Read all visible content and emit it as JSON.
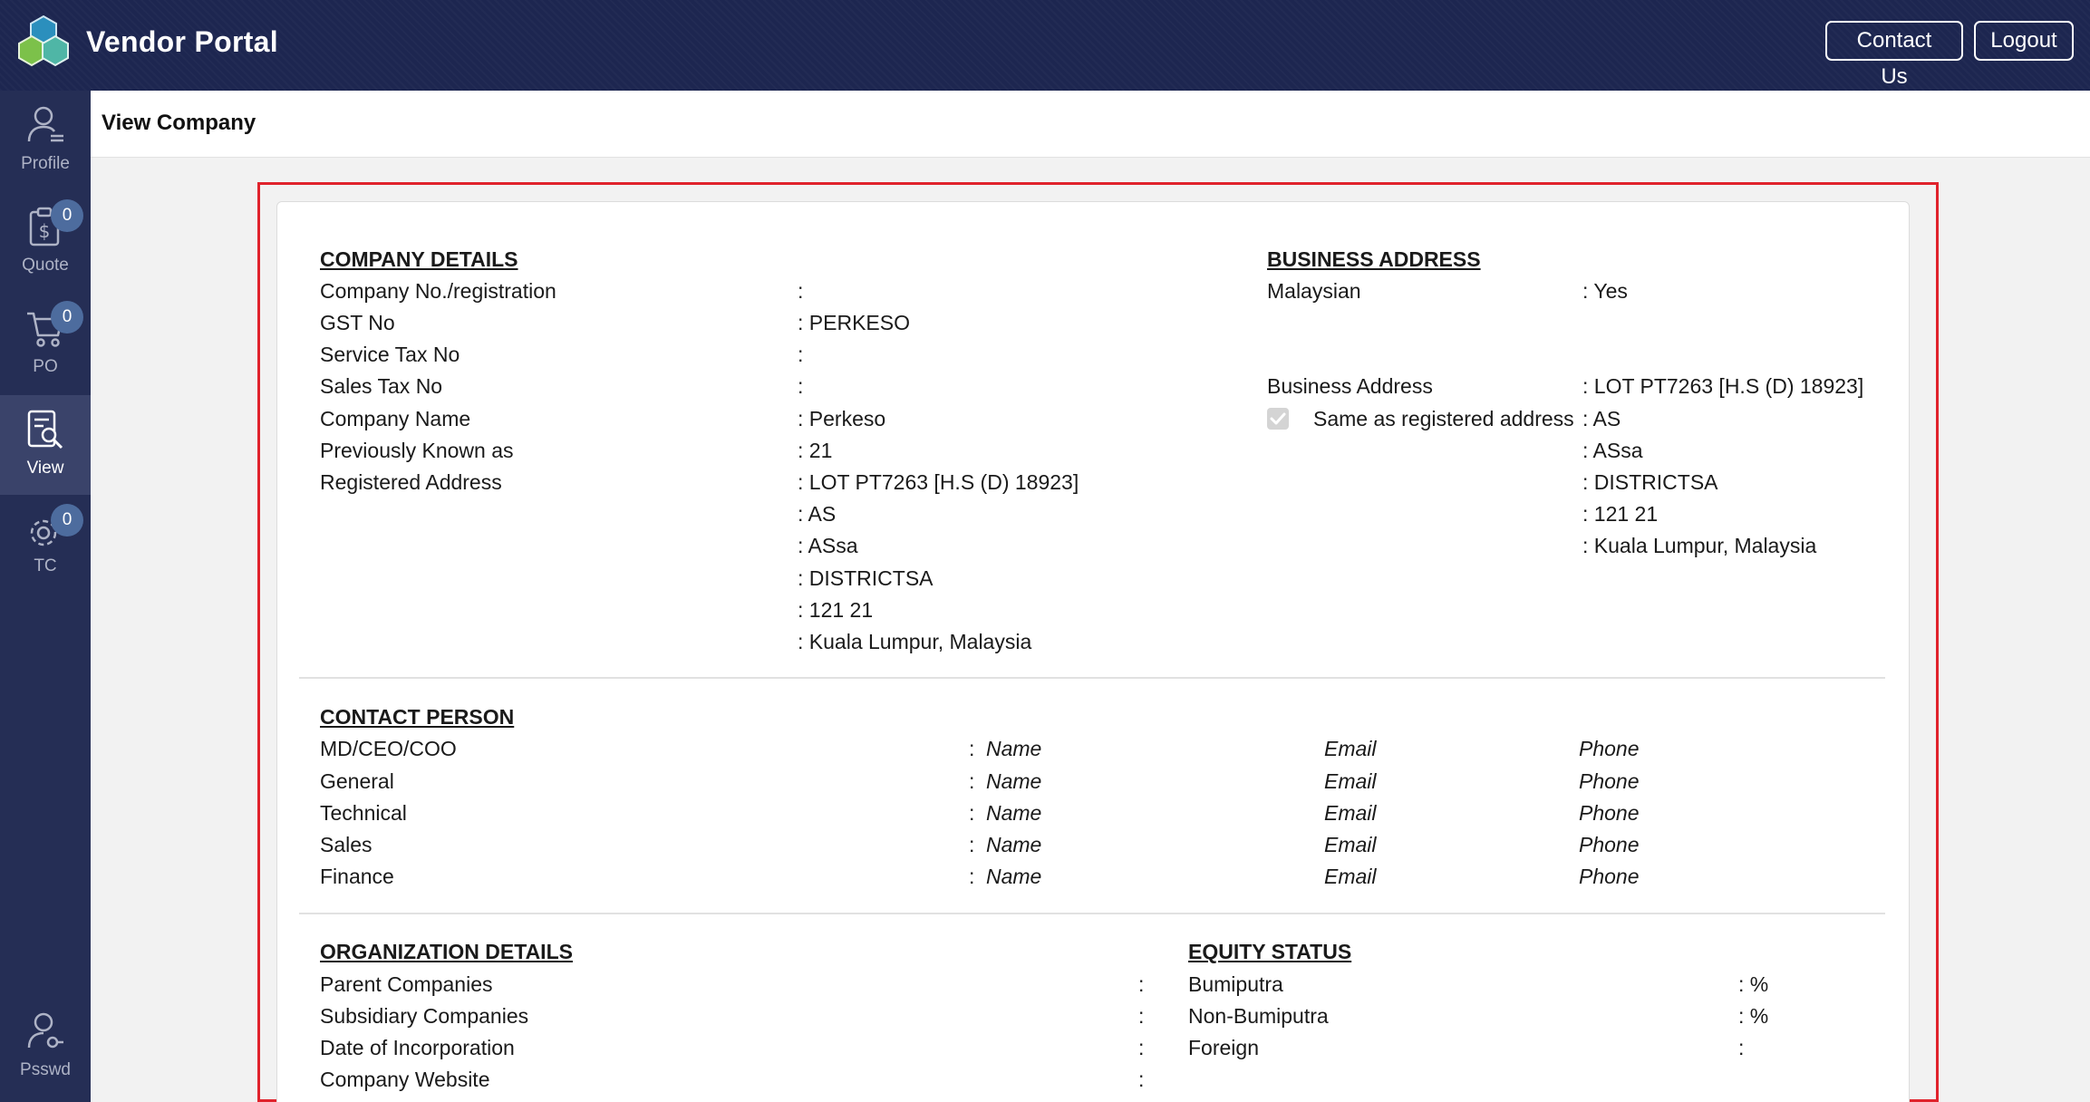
{
  "app": {
    "brand": "Vendor Portal"
  },
  "topbar": {
    "contact_label": "Contact Us",
    "logout_label": "Logout"
  },
  "sidebar": {
    "items": [
      {
        "label": "Profile",
        "icon": "profile-icon"
      },
      {
        "label": "Quote",
        "icon": "quote-icon",
        "badge": "0"
      },
      {
        "label": "PO",
        "icon": "cart-icon",
        "badge": "0"
      },
      {
        "label": "View",
        "icon": "view-icon",
        "active": true
      },
      {
        "label": "TC",
        "icon": "gear-icon",
        "badge": "0"
      },
      {
        "label": "Psswd",
        "icon": "password-icon"
      }
    ]
  },
  "page": {
    "title": "View Company"
  },
  "company_details": {
    "heading": "COMPANY DETAILS",
    "rows": [
      {
        "label": "Company No./registration",
        "value": ":"
      },
      {
        "label": "GST No",
        "value": ": PERKESO"
      },
      {
        "label": "Service Tax No",
        "value": ":"
      },
      {
        "label": "Sales Tax No",
        "value": ":"
      },
      {
        "label": "Company Name",
        "value": ": Perkeso"
      },
      {
        "label": "Previously Known as",
        "value": ": 21"
      },
      {
        "label": "Registered Address",
        "value": ": LOT PT7263 [H.S (D) 18923]"
      }
    ],
    "address_more": [
      ": AS",
      ": ASsa",
      ": DISTRICTSA",
      ": 121 21",
      ":  Kuala Lumpur, Malaysia"
    ]
  },
  "business_address": {
    "heading": "BUSINESS ADDRESS",
    "malaysian_label": "Malaysian",
    "malaysian_value": ": Yes",
    "address_label": "Business Address",
    "same_as_label": "Same as registered address",
    "same_as_checked": true,
    "address_lines": [
      ": LOT PT7263 [H.S (D) 18923]",
      ": AS",
      ": ASsa",
      ": DISTRICTSA",
      ": 121 21",
      ":  Kuala Lumpur, Malaysia"
    ]
  },
  "contact_person": {
    "heading": "CONTACT PERSON",
    "rows": [
      {
        "role": "MD/CEO/COO",
        "colon": ":",
        "name": "Name",
        "email": "Email",
        "phone": "Phone"
      },
      {
        "role": "General",
        "colon": ":",
        "name": "Name",
        "email": "Email",
        "phone": "Phone"
      },
      {
        "role": "Technical",
        "colon": ":",
        "name": "Name",
        "email": "Email",
        "phone": "Phone"
      },
      {
        "role": "Sales",
        "colon": ":",
        "name": "Name",
        "email": "Email",
        "phone": "Phone"
      },
      {
        "role": "Finance",
        "colon": ":",
        "name": "Name",
        "email": "Email",
        "phone": "Phone"
      }
    ]
  },
  "organization_details": {
    "heading": "ORGANIZATION DETAILS",
    "rows": [
      {
        "label": "Parent Companies",
        "value": ":"
      },
      {
        "label": "Subsidiary Companies",
        "value": ":"
      },
      {
        "label": "Date of Incorporation",
        "value": ":"
      },
      {
        "label": "Company Website",
        "value": ":"
      }
    ]
  },
  "equity_status": {
    "heading": "EQUITY STATUS",
    "rows": [
      {
        "label": "Bumiputra",
        "value": ":  %"
      },
      {
        "label": "Non-Bumiputra",
        "value": ":  %"
      },
      {
        "label": "Foreign",
        "value": ":"
      }
    ]
  },
  "colors": {
    "topbar": "#1d2650",
    "sidebar": "#252e55",
    "highlight": "#e0232c",
    "badge": "#4d6c9e"
  }
}
